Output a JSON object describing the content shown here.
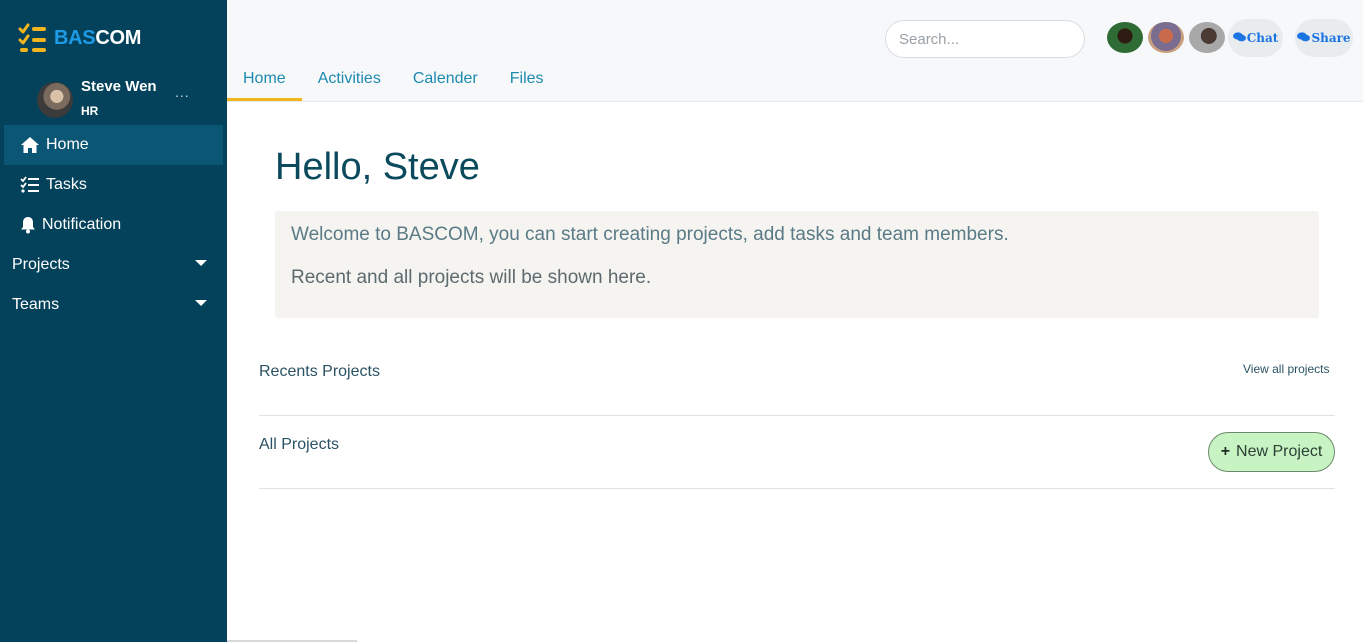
{
  "brand": {
    "part1": "BAS",
    "part2": "COM",
    "logo_icon": "checklist-icon"
  },
  "profile": {
    "name": "Steve Wen",
    "role": "HR",
    "more": "..."
  },
  "sidebar": {
    "items": [
      {
        "label": "Home",
        "icon": "home-icon",
        "active": true
      },
      {
        "label": "Tasks",
        "icon": "tasks-icon",
        "active": false
      },
      {
        "label": "Notification",
        "icon": "bell-icon",
        "active": false
      }
    ],
    "groups": [
      {
        "label": "Projects",
        "icon": "caret-down-icon"
      },
      {
        "label": "Teams",
        "icon": "caret-down-icon"
      }
    ]
  },
  "header": {
    "search": {
      "placeholder": "Search..."
    },
    "chat_label": "Chat",
    "share_label": "Share",
    "tabs": [
      {
        "label": "Home",
        "active": true
      },
      {
        "label": "Activities",
        "active": false
      },
      {
        "label": "Calender",
        "active": false
      },
      {
        "label": "Files",
        "active": false
      }
    ]
  },
  "main": {
    "greeting": "Hello, Steve",
    "welcome_line1": "Welcome to BASCOM, you can start creating projects, add tasks and team members.",
    "welcome_line2": "Recent and all projects will be shown here.",
    "recent_title": "Recents Projects",
    "view_all": "View all projects",
    "all_title": "All Projects",
    "new_project_plus": "+",
    "new_project_label": "New Project"
  },
  "colors": {
    "sidebar_bg": "#03425a",
    "accent_tab": "#f2b51d",
    "link": "#1d8ab0",
    "new_project_bg": "#c8f4c4"
  }
}
